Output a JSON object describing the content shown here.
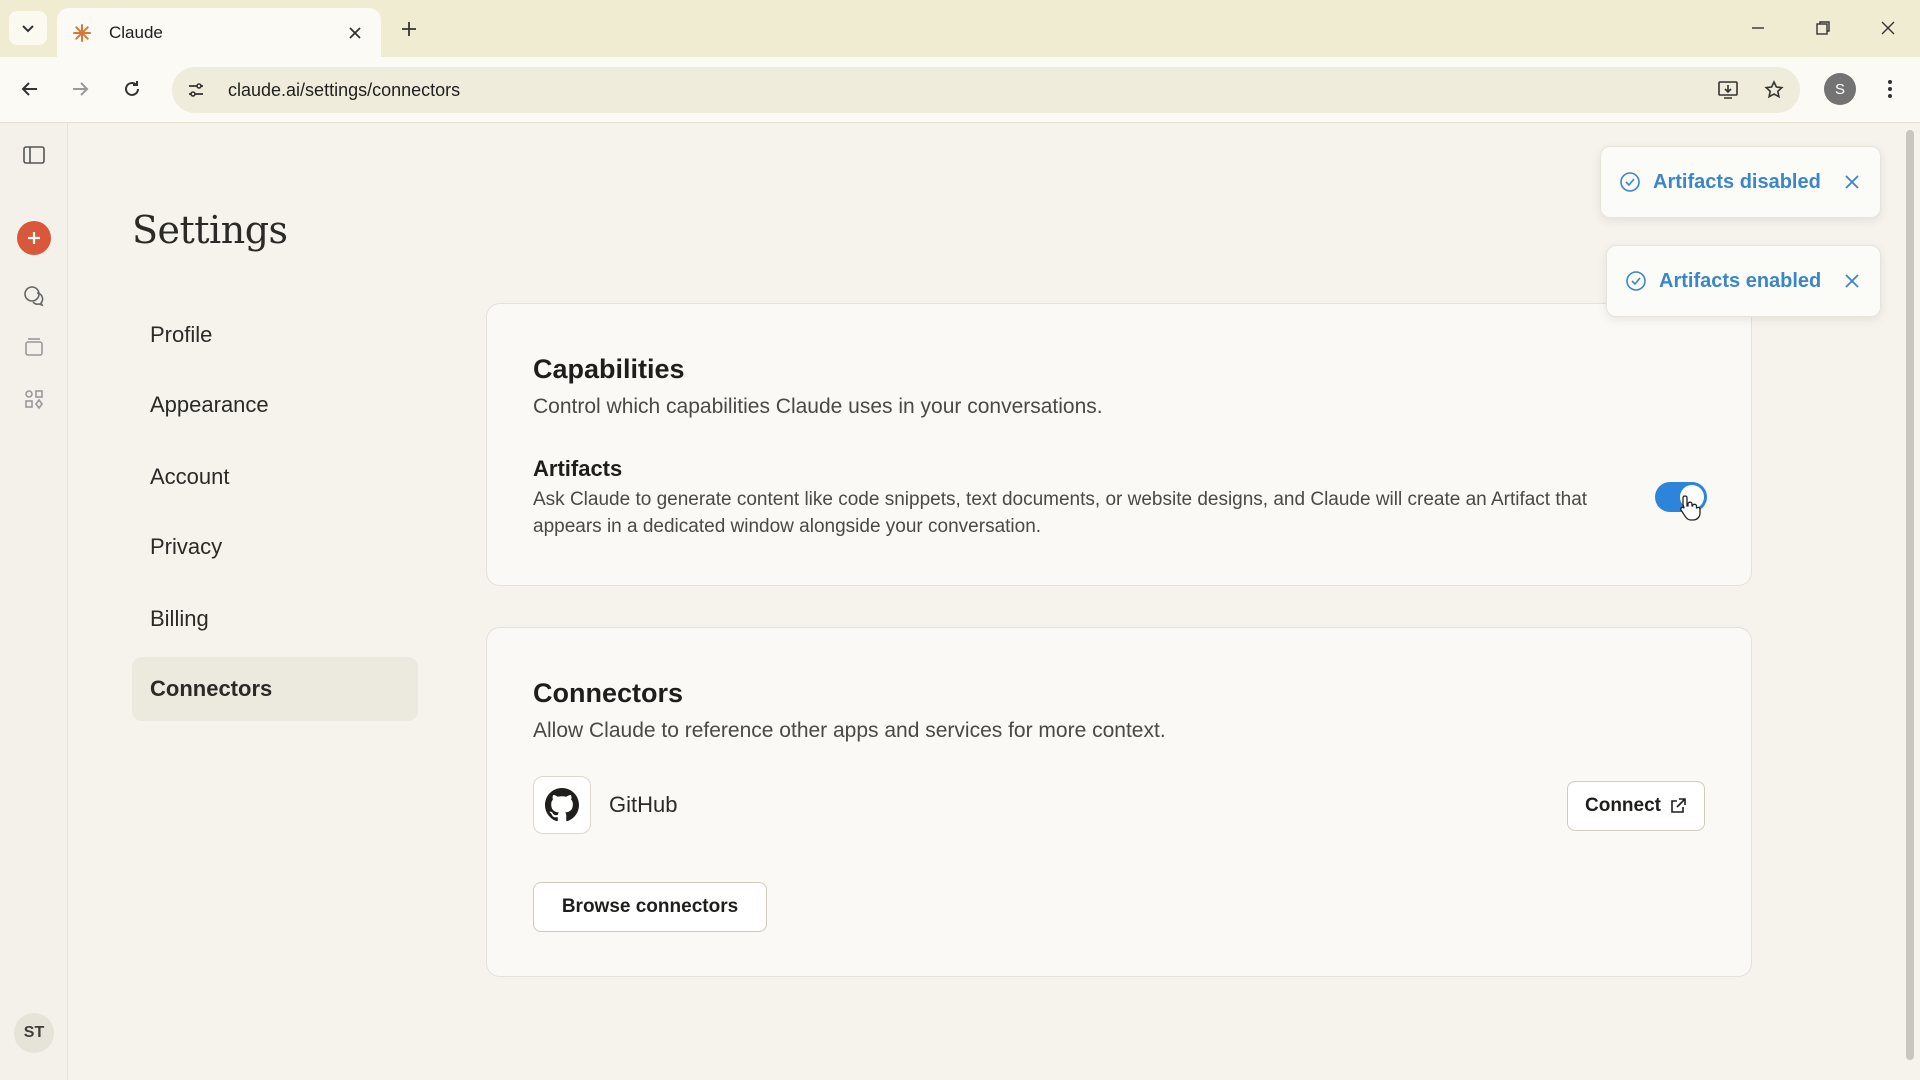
{
  "browser": {
    "tab_title": "Claude",
    "url": "claude.ai/settings/connectors",
    "profile_initial": "S"
  },
  "rail": {
    "user_initials": "ST"
  },
  "settings": {
    "title": "Settings",
    "nav": [
      {
        "label": "Profile",
        "active": false
      },
      {
        "label": "Appearance",
        "active": false
      },
      {
        "label": "Account",
        "active": false
      },
      {
        "label": "Privacy",
        "active": false
      },
      {
        "label": "Billing",
        "active": false
      },
      {
        "label": "Connectors",
        "active": true
      }
    ]
  },
  "capabilities": {
    "title": "Capabilities",
    "subtitle": "Control which capabilities Claude uses in your conversations.",
    "artifacts": {
      "title": "Artifacts",
      "description": "Ask Claude to generate content like code snippets, text documents, or website designs, and Claude will create an Artifact that appears in a dedicated window alongside your conversation.",
      "enabled": true
    }
  },
  "connectors": {
    "title": "Connectors",
    "subtitle": "Allow Claude to reference other apps and services for more context.",
    "items": [
      {
        "name": "GitHub",
        "action_label": "Connect"
      }
    ],
    "browse_label": "Browse connectors"
  },
  "toasts": [
    {
      "text": "Artifacts disabled"
    },
    {
      "text": "Artifacts enabled"
    }
  ],
  "colors": {
    "accent": "#2c84db",
    "toast_text": "#3b86c8",
    "claude_orange": "#d9573b"
  }
}
